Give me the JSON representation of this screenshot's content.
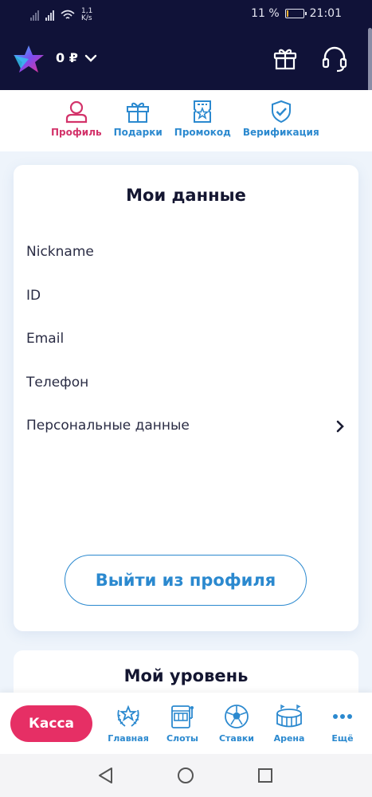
{
  "status_bar": {
    "net_speed": "1,1",
    "net_speed_unit": "K/s",
    "battery_percent": "11 %",
    "battery_level": 0.11,
    "time": "21:01"
  },
  "header": {
    "balance": "0 ₽"
  },
  "tabs": [
    {
      "label": "Профиль",
      "icon": "user-icon",
      "active": true
    },
    {
      "label": "Подарки",
      "icon": "gift-icon",
      "active": false
    },
    {
      "label": "Промокод",
      "icon": "ticket-icon",
      "active": false
    },
    {
      "label": "Верификация",
      "icon": "shield-check-icon",
      "active": false
    }
  ],
  "my_data": {
    "title": "Мои данные",
    "rows": [
      "Nickname",
      "ID",
      "Email",
      "Телефон",
      "Персональные данные"
    ],
    "logout": "Выйти из профиля"
  },
  "my_level": {
    "title": "Мой уровень"
  },
  "bottom_nav": {
    "cashier": "Касса",
    "items": [
      {
        "label": "Главная",
        "icon": "laurel-star-icon"
      },
      {
        "label": "Слоты",
        "icon": "slot-machine-icon"
      },
      {
        "label": "Ставки",
        "icon": "soccer-ball-icon"
      },
      {
        "label": "Арена",
        "icon": "stadium-icon"
      },
      {
        "label": "Ещё",
        "icon": "more-dots-icon"
      }
    ]
  },
  "colors": {
    "header_bg": "#101238",
    "accent_blue": "#2b89cf",
    "accent_pink": "#d3336a",
    "cashier_button": "#e62f65",
    "page_bg": "#eef4fb"
  }
}
